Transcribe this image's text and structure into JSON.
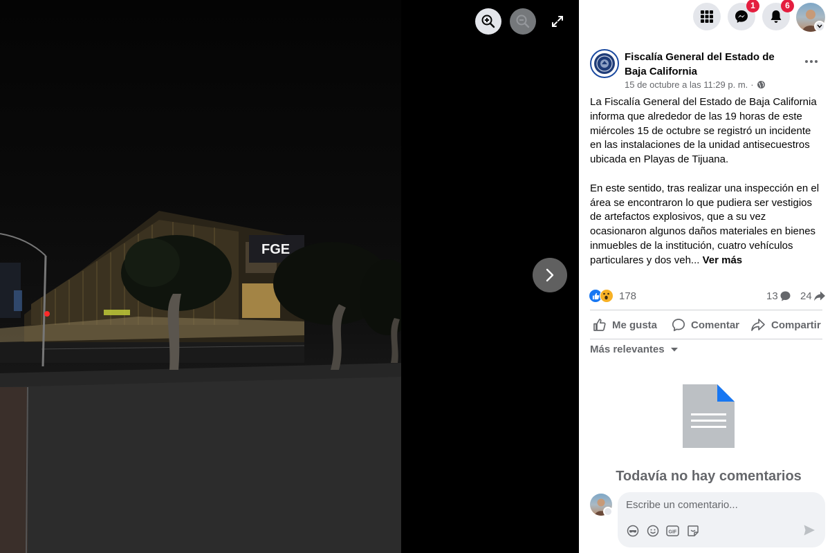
{
  "viewer": {
    "photo_sign": "FGE",
    "icons": {
      "zoom_in": "zoom-in-icon",
      "zoom_out": "zoom-out-icon",
      "fullscreen": "fullscreen-icon",
      "next": "chevron-right-icon"
    }
  },
  "topbar": {
    "messenger_badge": "1",
    "notifications_badge": "6"
  },
  "post": {
    "page_name": "Fiscalía General del Estado de Baja California",
    "timestamp": "15 de octubre a las 11:29 p. m.",
    "audience_icon": "globe-icon",
    "paragraph_1": "La Fiscalía General del Estado de Baja California informa que alrededor de las 19 horas de este miércoles 15 de octubre se registró un incidente en las instalaciones de la unidad antisecuestros ubicada en Playas de Tijuana.",
    "paragraph_2": "En este sentido, tras realizar una inspección en el área se encontraron lo que pudiera ser vestigios de artefactos explosivos, que a su vez ocasionaron algunos daños materiales en bienes inmuebles de la institución, cuatro vehículos particulares y dos veh...",
    "see_more": "Ver más"
  },
  "stats": {
    "reactions": "178",
    "comments": "13",
    "shares": "24"
  },
  "actions": {
    "like": "Me gusta",
    "comment": "Comentar",
    "share": "Compartir"
  },
  "comments": {
    "sort_label": "Más relevantes",
    "empty_title": "Todavía no hay comentarios",
    "placeholder": "Escribe un comentario..."
  },
  "colors": {
    "accent": "#1877f2",
    "badge": "#e41e3f",
    "muted": "#65676b"
  }
}
